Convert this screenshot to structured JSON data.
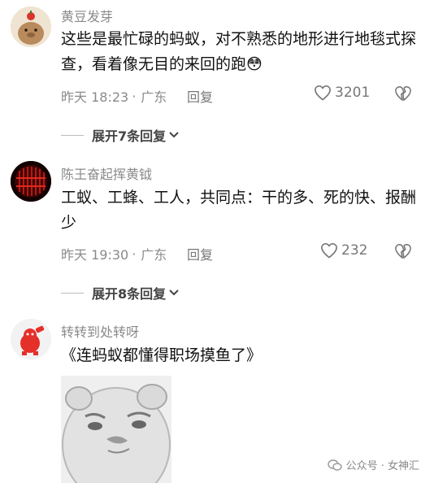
{
  "comments": [
    {
      "username": "黄豆发芽",
      "text": "这些是最忙碌的蚂蚁，对不熟悉的地形进行地毯式探查，看着像无目的来回的跑",
      "emoji": "😳",
      "time": "昨天 18:23",
      "location": "广东",
      "reply_label": "回复",
      "likes": "3201",
      "expand_label": "展开7条回复"
    },
    {
      "username": "陈王奋起挥黄钺",
      "text": "工蚁、工蜂、工人，共同点：干的多、死的快、报酬少",
      "time": "昨天 19:30",
      "location": "广东",
      "reply_label": "回复",
      "likes": "232",
      "expand_label": "展开8条回复"
    },
    {
      "username": "转转到处转呀",
      "text": "《连蚂蚁都懂得职场摸鱼了》"
    }
  ],
  "watermark": {
    "text": "公众号 · 女神汇"
  }
}
